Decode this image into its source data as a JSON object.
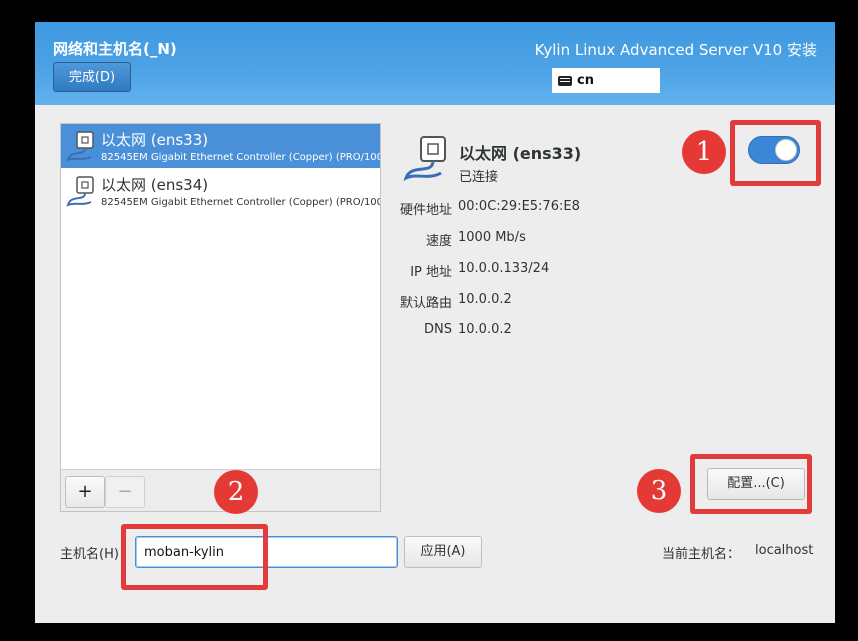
{
  "header": {
    "title": "网络和主机名(_N)",
    "done_label": "完成(D)",
    "product": "Kylin Linux Advanced Server V10 安装",
    "keyboard_layout": "cn"
  },
  "devices": [
    {
      "name": "以太网 (ens33)",
      "desc": "82545EM Gigabit Ethernet Controller (Copper) (PRO/1000",
      "selected": true
    },
    {
      "name": "以太网 (ens34)",
      "desc": "82545EM Gigabit Ethernet Controller (Copper) (PRO/1000",
      "selected": false
    }
  ],
  "list_toolbar": {
    "add": "+",
    "remove": "−"
  },
  "detail": {
    "name": "以太网 (ens33)",
    "status": "已连接",
    "props": [
      {
        "label": "硬件地址",
        "value": "00:0C:29:E5:76:E8"
      },
      {
        "label": "速度",
        "value": "1000 Mb/s"
      },
      {
        "label": "IP 地址",
        "value": "10.0.0.133/24"
      },
      {
        "label": "默认路由",
        "value": "10.0.0.2"
      },
      {
        "label": "DNS",
        "value": "10.0.0.2"
      }
    ],
    "toggle_on": true
  },
  "config_label": "配置...(C)",
  "hostname": {
    "label": "主机名(H)：",
    "value": "moban-kylin",
    "apply_label": "应用(A)",
    "current_label": "当前主机名：",
    "current_value": "localhost"
  },
  "annotations": [
    "1",
    "2",
    "3"
  ],
  "colors": {
    "accent": "#4a90d9",
    "annotation": "#e23b3b",
    "header": "#4ca2e5"
  }
}
